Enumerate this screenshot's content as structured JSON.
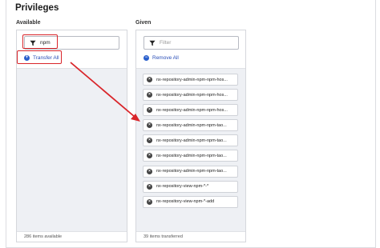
{
  "title": "Privileges",
  "available": {
    "label": "Available",
    "filter_value": "npm",
    "transfer_all_label": "Transfer All",
    "footer": "286 items available"
  },
  "given": {
    "label": "Given",
    "filter_placeholder": "Filter",
    "remove_all_label": "Remove All",
    "footer": "39 items transferred",
    "items": [
      "nx-repository-admin-npm-npm-hos...",
      "nx-repository-admin-npm-npm-hos...",
      "nx-repository-admin-npm-npm-hos...",
      "nx-repository-admin-npm-npm-tao...",
      "nx-repository-admin-npm-npm-tao...",
      "nx-repository-admin-npm-npm-tao...",
      "nx-repository-admin-npm-npm-tao...",
      "nx-repository-view-npm-*-*",
      "nx-repository-view-npm-*-add"
    ]
  },
  "colors": {
    "highlight": "#d9252a",
    "link": "#2a4fb8",
    "panel_bg": "#eef0f4"
  }
}
